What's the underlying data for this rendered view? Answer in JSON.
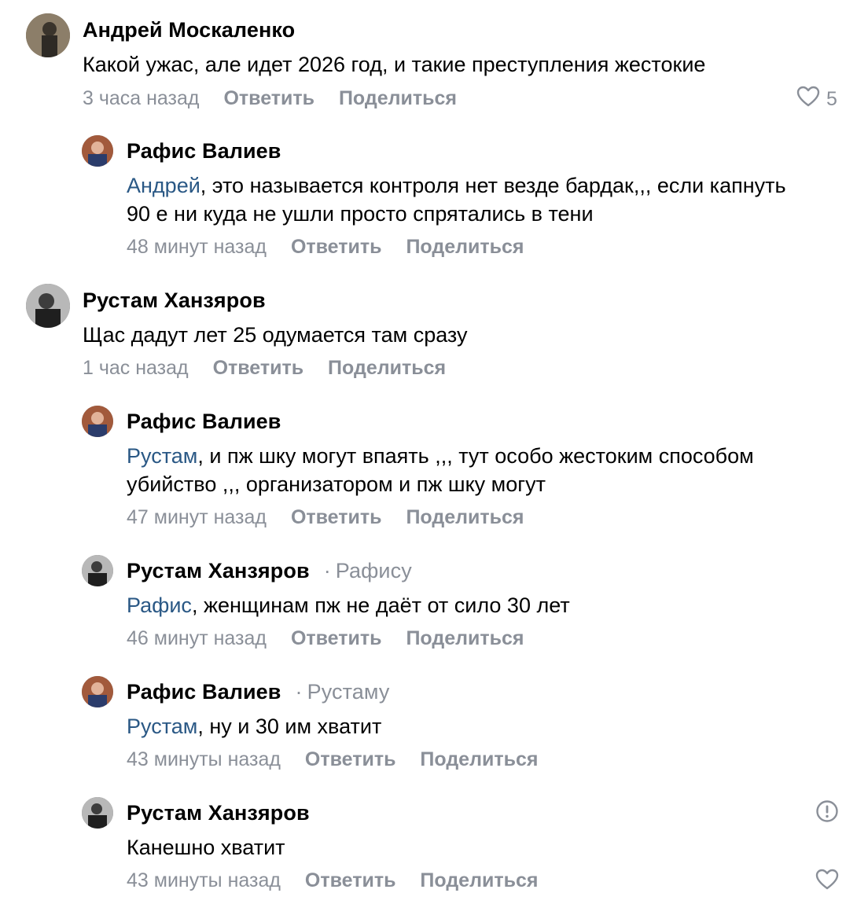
{
  "ui": {
    "reply": "Ответить",
    "share": "Поделиться",
    "separator": "·"
  },
  "comments": [
    {
      "author": "Андрей Москаленко",
      "text": "Какой ужас, але идет 2026 год, и такие преступления жестокие",
      "time": "3 часа назад",
      "likes": "5"
    },
    {
      "author": "Рафис Валиев",
      "mention": "Андрей",
      "text_line1": ", это называется контроля нет везде бардак,,, если капнуть",
      "text_line2": "90 е ни куда не ушли просто спрятались в тени",
      "time": "48 минут назад"
    },
    {
      "author": "Рустам Ханзяров",
      "text": "Щас дадут лет 25 одумается там сразу",
      "time": "1 час назад"
    },
    {
      "author": "Рафис Валиев",
      "mention": "Рустам",
      "text_line1": ", и пж шку могут впаять ,,, тут особо жестоким способом",
      "text_line2": "убийство ,,, организатором и пж шку могут",
      "time": "47 минут назад"
    },
    {
      "author": "Рустам Ханзяров",
      "reply_to": "Рафису",
      "mention": "Рафис",
      "text": ", женщинам пж не даёт от сило 30 лет",
      "time": "46 минут назад"
    },
    {
      "author": "Рафис Валиев",
      "reply_to": "Рустаму",
      "mention": "Рустам",
      "text": ", ну и 30 им хватит",
      "time": "43 минуты назад"
    },
    {
      "author": "Рустам Ханзяров",
      "text": "Канешно хватит",
      "time": "43 минуты назад"
    }
  ],
  "icons": {
    "like": "heart-icon",
    "report": "exclamation-circle-icon"
  },
  "colors": {
    "mention": "#2a5885",
    "secondary": "#8a8f98"
  }
}
